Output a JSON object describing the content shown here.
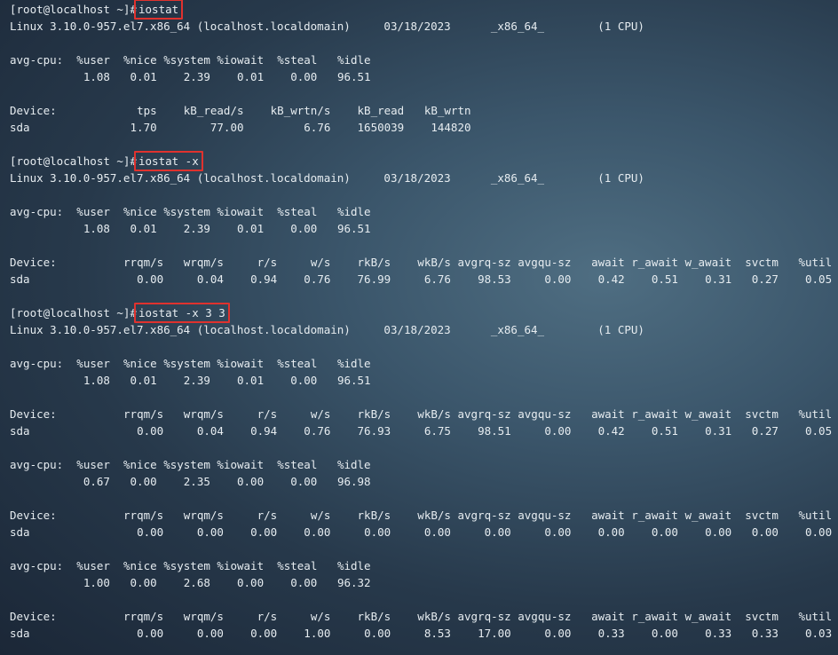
{
  "terminal": {
    "prompt": "[root@localhost ~]#",
    "blocks": [
      {
        "command": "iostat",
        "sysinfo": "Linux 3.10.0-957.el7.x86_64 (localhost.localdomain)     03/18/2023      _x86_64_        (1 CPU)",
        "reports": [
          {
            "cpu_label": "avg-cpu:",
            "cpu_headers": [
              "%user",
              "%nice",
              "%system",
              "%iowait",
              "%steal",
              "%idle"
            ],
            "cpu_values": [
              "1.08",
              "0.01",
              "2.39",
              "0.01",
              "0.00",
              "96.51"
            ],
            "dev_headers": [
              "Device:",
              "tps",
              "kB_read/s",
              "kB_wrtn/s",
              "kB_read",
              "kB_wrtn"
            ],
            "dev_rows": [
              [
                "sda",
                "1.70",
                "77.00",
                "6.76",
                "1650039",
                "144820"
              ]
            ]
          }
        ]
      },
      {
        "command": "iostat -x",
        "sysinfo": "Linux 3.10.0-957.el7.x86_64 (localhost.localdomain)     03/18/2023      _x86_64_        (1 CPU)",
        "reports": [
          {
            "cpu_label": "avg-cpu:",
            "cpu_headers": [
              "%user",
              "%nice",
              "%system",
              "%iowait",
              "%steal",
              "%idle"
            ],
            "cpu_values": [
              "1.08",
              "0.01",
              "2.39",
              "0.01",
              "0.00",
              "96.51"
            ],
            "dev_headers": [
              "Device:",
              "rrqm/s",
              "wrqm/s",
              "r/s",
              "w/s",
              "rkB/s",
              "wkB/s",
              "avgrq-sz",
              "avgqu-sz",
              "await",
              "r_await",
              "w_await",
              "svctm",
              "%util"
            ],
            "dev_rows": [
              [
                "sda",
                "0.00",
                "0.04",
                "0.94",
                "0.76",
                "76.99",
                "6.76",
                "98.53",
                "0.00",
                "0.42",
                "0.51",
                "0.31",
                "0.27",
                "0.05"
              ]
            ]
          }
        ]
      },
      {
        "command": "iostat -x 3 3",
        "sysinfo": "Linux 3.10.0-957.el7.x86_64 (localhost.localdomain)     03/18/2023      _x86_64_        (1 CPU)",
        "reports": [
          {
            "cpu_label": "avg-cpu:",
            "cpu_headers": [
              "%user",
              "%nice",
              "%system",
              "%iowait",
              "%steal",
              "%idle"
            ],
            "cpu_values": [
              "1.08",
              "0.01",
              "2.39",
              "0.01",
              "0.00",
              "96.51"
            ],
            "dev_headers": [
              "Device:",
              "rrqm/s",
              "wrqm/s",
              "r/s",
              "w/s",
              "rkB/s",
              "wkB/s",
              "avgrq-sz",
              "avgqu-sz",
              "await",
              "r_await",
              "w_await",
              "svctm",
              "%util"
            ],
            "dev_rows": [
              [
                "sda",
                "0.00",
                "0.04",
                "0.94",
                "0.76",
                "76.93",
                "6.75",
                "98.51",
                "0.00",
                "0.42",
                "0.51",
                "0.31",
                "0.27",
                "0.05"
              ]
            ]
          },
          {
            "cpu_label": "avg-cpu:",
            "cpu_headers": [
              "%user",
              "%nice",
              "%system",
              "%iowait",
              "%steal",
              "%idle"
            ],
            "cpu_values": [
              "0.67",
              "0.00",
              "2.35",
              "0.00",
              "0.00",
              "96.98"
            ],
            "dev_headers": [
              "Device:",
              "rrqm/s",
              "wrqm/s",
              "r/s",
              "w/s",
              "rkB/s",
              "wkB/s",
              "avgrq-sz",
              "avgqu-sz",
              "await",
              "r_await",
              "w_await",
              "svctm",
              "%util"
            ],
            "dev_rows": [
              [
                "sda",
                "0.00",
                "0.00",
                "0.00",
                "0.00",
                "0.00",
                "0.00",
                "0.00",
                "0.00",
                "0.00",
                "0.00",
                "0.00",
                "0.00",
                "0.00"
              ]
            ]
          },
          {
            "cpu_label": "avg-cpu:",
            "cpu_headers": [
              "%user",
              "%nice",
              "%system",
              "%iowait",
              "%steal",
              "%idle"
            ],
            "cpu_values": [
              "1.00",
              "0.00",
              "2.68",
              "0.00",
              "0.00",
              "96.32"
            ],
            "dev_headers": [
              "Device:",
              "rrqm/s",
              "wrqm/s",
              "r/s",
              "w/s",
              "rkB/s",
              "wkB/s",
              "avgrq-sz",
              "avgqu-sz",
              "await",
              "r_await",
              "w_await",
              "svctm",
              "%util"
            ],
            "dev_rows": [
              [
                "sda",
                "0.00",
                "0.00",
                "0.00",
                "1.00",
                "0.00",
                "8.53",
                "17.00",
                "0.00",
                "0.33",
                "0.00",
                "0.33",
                "0.33",
                "0.03"
              ]
            ]
          }
        ]
      }
    ]
  },
  "colors": {
    "text": "#e6ecf0",
    "highlight_box": "#e0322e"
  }
}
